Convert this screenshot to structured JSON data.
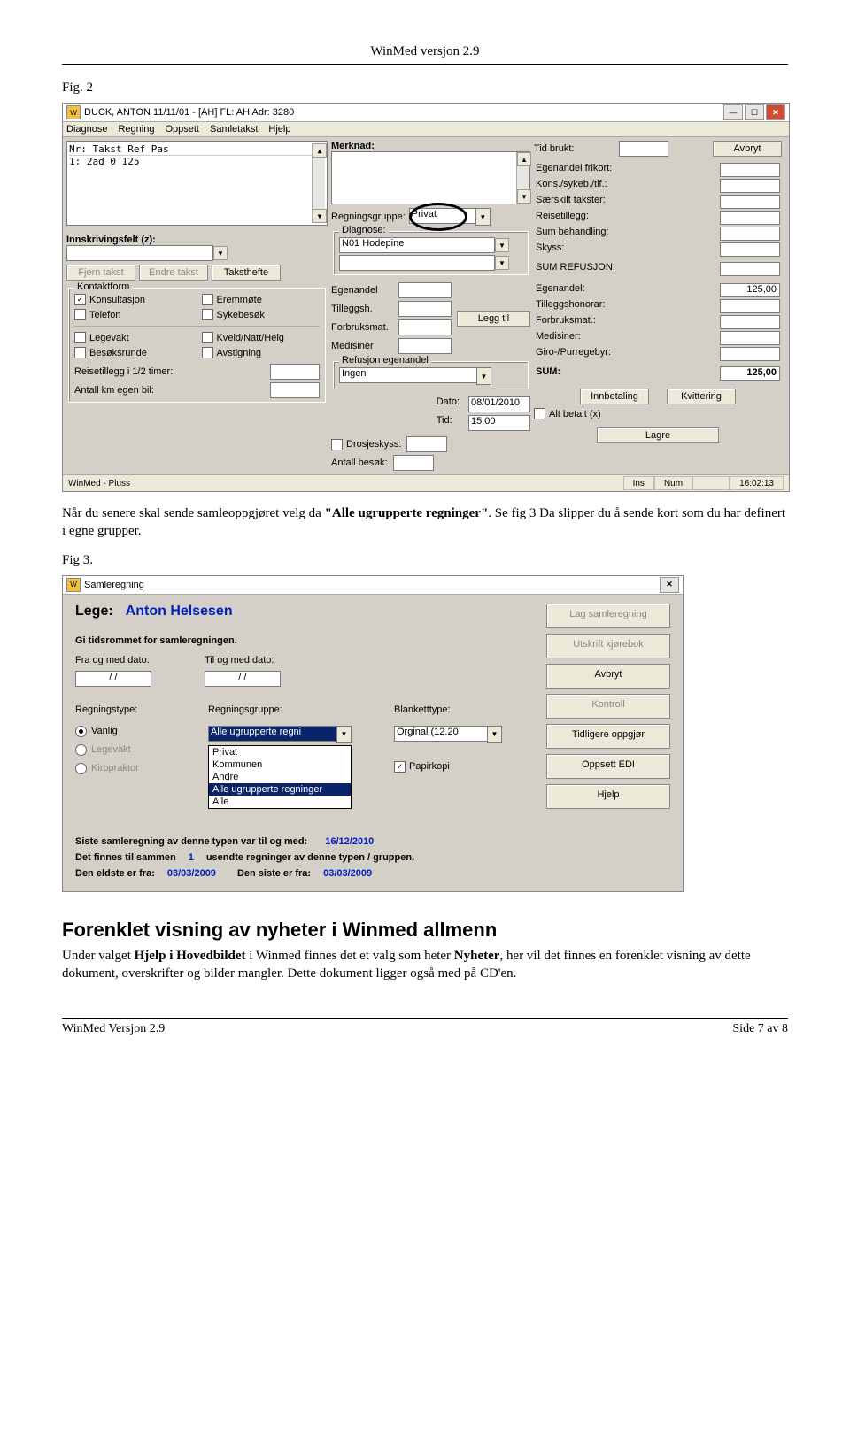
{
  "doc": {
    "header": "WinMed versjon 2.9",
    "fig2_label": "Fig. 2",
    "para1_pre": "Når du senere skal sende samleoppgjøret velg da ",
    "para1_bold": "\"Alle ugrupperte regninger\"",
    "para1_post": ". Se fig 3 Da slipper du å sende kort som du har definert i egne grupper.",
    "fig3_label": "Fig 3.",
    "h2": "Forenklet visning av nyheter i Winmed allmenn",
    "para2_a": "Under valget ",
    "para2_b": "Hjelp i Hovedbildet",
    "para2_c": " i Winmed finnes det et valg som heter ",
    "para2_d": "Nyheter",
    "para2_e": ", her vil det finnes en forenklet visning av dette dokument, overskrifter og bilder mangler. Dette dokument ligger også med på CD'en.",
    "footer_left": "WinMed Versjon 2.9",
    "footer_right": "Side 7 av 8"
  },
  "fig2": {
    "title": "DUCK, ANTON 11/11/01 - [AH] FL: AH Adr: 3280",
    "menus": [
      "Diagnose",
      "Regning",
      "Oppsett",
      "Samletakst",
      "Hjelp"
    ],
    "list_header": "Nr:  Takst              Ref    Pas",
    "list_row": " 1:  2ad                  0    125",
    "merknad_label": "Merknad:",
    "regningsgruppe_label": "Regningsgruppe:",
    "regningsgruppe_value": "Privat",
    "diagnose_legend": "Diagnose:",
    "diagnose_value": "N01 Hodepine",
    "innskriv_label": "Innskrivingsfelt (z):",
    "btn_fjern": "Fjern takst",
    "btn_endre": "Endre takst",
    "btn_hefte": "Taksthefte",
    "kontakt_legend": "Kontaktform",
    "kontakt": {
      "konsult": "Konsultasjon",
      "fremm": "Eremmøte",
      "telefon": "Telefon",
      "syke": "Sykebesøk",
      "lege": "Legevakt",
      "kveld": "Kveld/Natt/Helg",
      "besok": "Besøksrunde",
      "avst": "Avstigning"
    },
    "reise_label": "Reisetillegg i 1/2 timer:",
    "antkm_label": "Antall km egen bil:",
    "mid_labels": {
      "egenandel": "Egenandel",
      "tilleggsh": "Tilleggsh.",
      "forbruks": "Forbruksmat.",
      "medisiner": "Medisiner"
    },
    "btn_leggtil": "Legg til",
    "refusjon_legend": "Refusjon egenandel",
    "refusjon_value": "Ingen",
    "dato_label": "Dato:",
    "dato_value": "08/01/2010",
    "tid_label": "Tid:",
    "tid_value": "15:00",
    "drosje_label": "Drosjeskyss:",
    "antbesok_label": "Antall besøk:",
    "right": {
      "tidbrukt": "Tid brukt:",
      "btn_avbryt": "Avbryt",
      "rows": [
        "Egenandel frikort:",
        "Kons./sykeb./tlf.:",
        "Særskilt takster:",
        "Reisetillegg:",
        "Sum behandling:",
        "Skyss:",
        "SUM REFUSJON:",
        "Egenandel:",
        "Tilleggshonorar:",
        "Forbruksmat.:",
        "Medisiner:",
        "Giro-/Purregebyr:",
        "SUM:"
      ],
      "val_egenandel": "125,00",
      "val_sum": "125,00",
      "btn_innbet": "Innbetaling",
      "btn_kvitt": "Kvittering",
      "chk_altbetalt": "Alt betalt (x)",
      "btn_lagre": "Lagre"
    },
    "status_left": "WinMed - Pluss",
    "status_ins": "Ins",
    "status_num": "Num",
    "status_time": "16:02:13"
  },
  "fig3": {
    "title": "Samleregning",
    "lege_label": "Lege:",
    "lege_value": "Anton Helsesen",
    "gi_label": "Gi tidsrommet for samleregningen.",
    "fra_label": "Fra og med dato:",
    "til_label": "Til og med dato:",
    "date_placeholder": "  /  /",
    "regtype_label": "Regningstype:",
    "reggrp_label": "Regningsgruppe:",
    "blank_label": "Blanketttype:",
    "radio_vanlig": "Vanlig",
    "radio_lege": "Legevakt",
    "radio_kiro": "Kiropraktor",
    "dd_selected": "Alle ugrupperte regni",
    "dd_items": [
      "Privat",
      "Kommunen",
      "Andre",
      "Alle ugrupperte regninger",
      "Alle"
    ],
    "blank_value": "Orginal (12.20",
    "chk_papir": "Papirkopi",
    "rbtns": [
      "Lag samleregning",
      "Utskrift kjørebok",
      "Avbryt",
      "Kontroll",
      "Tidligere oppgjør",
      "Oppsett EDI",
      "Hjelp"
    ],
    "line1_a": "Siste samleregning av denne typen var til og med:",
    "line1_b": "16/12/2010",
    "line2_a": "Det finnes til sammen",
    "line2_n": "1",
    "line2_b": "usendte regninger av denne typen / gruppen.",
    "line3_a": "Den eldste er fra:",
    "line3_b": "03/03/2009",
    "line3_c": "Den siste er fra:",
    "line3_d": "03/03/2009"
  }
}
